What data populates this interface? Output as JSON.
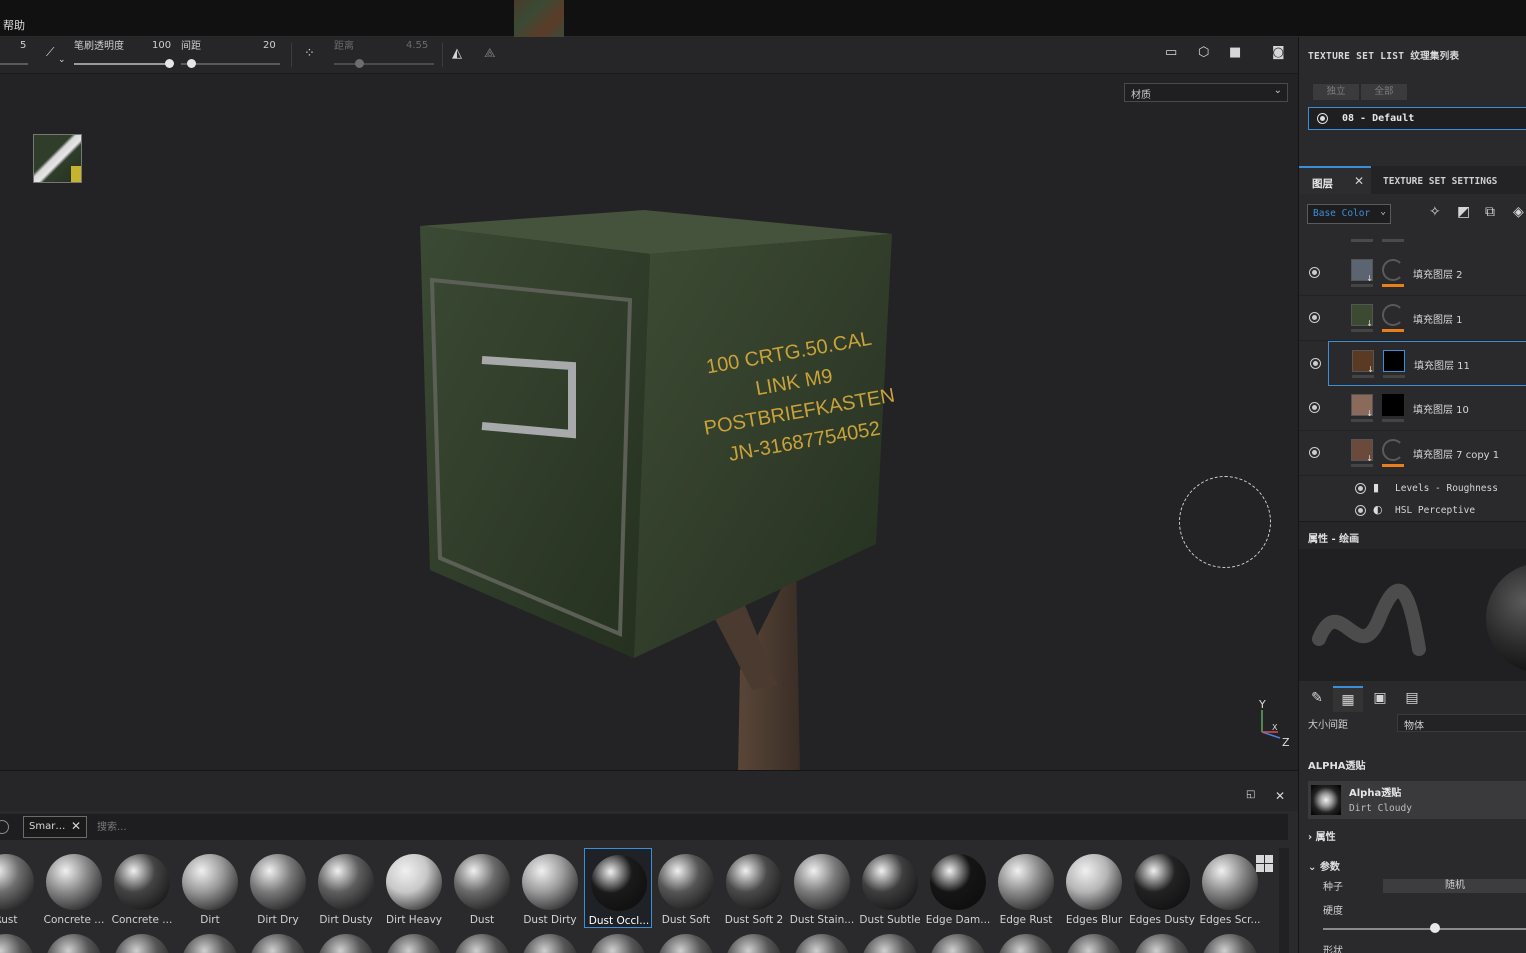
{
  "menubar": {
    "help": "帮助"
  },
  "toolbar": {
    "size_value": "5",
    "flow_label": "笔刷透明度",
    "flow_value": "100",
    "spacing_label": "间距",
    "spacing_value": "20",
    "distance_label": "距离",
    "distance_value": "4.55",
    "flow_level": 1.0,
    "spacing_level": 0.2
  },
  "viewport": {
    "material_select": "材质",
    "box_stencil_lines": [
      "100 CRTG.50.CAL",
      "LINK M9",
      "POSTBRIEFKASTEN",
      "JN-31687754052"
    ],
    "axis_labels": {
      "y": "Y",
      "x": "X",
      "z": "Z"
    }
  },
  "shelf": {
    "filter_chip": "Smar…",
    "search_placeholder": "搜索...",
    "items": [
      {
        "label": "Rust",
        "tone": "#6e6e6e"
      },
      {
        "label": "Concrete ...",
        "tone": "#8a8a8a"
      },
      {
        "label": "Concrete ...",
        "tone": "#444444"
      },
      {
        "label": "Dirt",
        "tone": "#9a9a9a"
      },
      {
        "label": "Dirt Dry",
        "tone": "#7a7a7a"
      },
      {
        "label": "Dirt Dusty",
        "tone": "#5e5e5e"
      },
      {
        "label": "Dirt Heavy",
        "tone": "#c8c8c8"
      },
      {
        "label": "Dust",
        "tone": "#6a6a6a"
      },
      {
        "label": "Dust Dirty",
        "tone": "#9c9c9c"
      },
      {
        "label": "Dust Occl...",
        "tone": "#1a1a1a",
        "selected": true
      },
      {
        "label": "Dust Soft",
        "tone": "#555555"
      },
      {
        "label": "Dust Soft 2",
        "tone": "#4a4a4a"
      },
      {
        "label": "Dust Stain...",
        "tone": "#7d7d7d"
      },
      {
        "label": "Dust Subtle",
        "tone": "#3e3e3e"
      },
      {
        "label": "Edge Dam...",
        "tone": "#151515"
      },
      {
        "label": "Edge Rust",
        "tone": "#8c8c8c"
      },
      {
        "label": "Edges Blur",
        "tone": "#b5b5b5"
      },
      {
        "label": "Edges Dusty",
        "tone": "#222222"
      },
      {
        "label": "Edges Scr...",
        "tone": "#8a8a8a"
      }
    ]
  },
  "texture_set_list": {
    "title": "TEXTURE SET LIST 纹理集列表",
    "btn_isolate": "独立",
    "btn_all": "全部",
    "selected_set": "08 - Default"
  },
  "layers_panel": {
    "tab_layers": "图层",
    "tab_settings": "TEXTURE SET SETTINGS",
    "channel": "Base Color",
    "layers": [
      {
        "name": "填充图层 2",
        "swatch": "#5b6470",
        "mask": "ring",
        "bar": "or",
        "selected": false
      },
      {
        "name": "填充图层 1",
        "swatch": "#3d4a32",
        "mask": "ring",
        "bar": "or",
        "selected": false
      },
      {
        "name": "填充图层 11",
        "swatch": "#5a3a22",
        "mask": "black",
        "bar": "",
        "selected": true
      },
      {
        "name": "填充图层 10",
        "swatch": "#8a6a5a",
        "mask": "black",
        "bar": "",
        "selected": false
      },
      {
        "name": "填充图层 7 copy 1",
        "swatch": "#6a4a3a",
        "mask": "ring",
        "bar": "or",
        "selected": false
      }
    ],
    "effects": [
      {
        "name": "Levels - Roughness",
        "icon": "levels-icon"
      },
      {
        "name": "HSL Perceptive",
        "icon": "hsl-icon"
      }
    ]
  },
  "properties": {
    "title": "属性 - 绘画",
    "size_spacing_label": "大小间距",
    "space_value": "物体",
    "alpha_section": "ALPHA透贴",
    "alpha_name": "Alpha透贴",
    "alpha_sub": "Dirt Cloudy",
    "attributes": "属性",
    "params": "参数",
    "seed_label": "种子",
    "seed_button": "随机",
    "hardness_label": "硬度",
    "hardness_level": 0.55,
    "shape_label": "形状"
  }
}
